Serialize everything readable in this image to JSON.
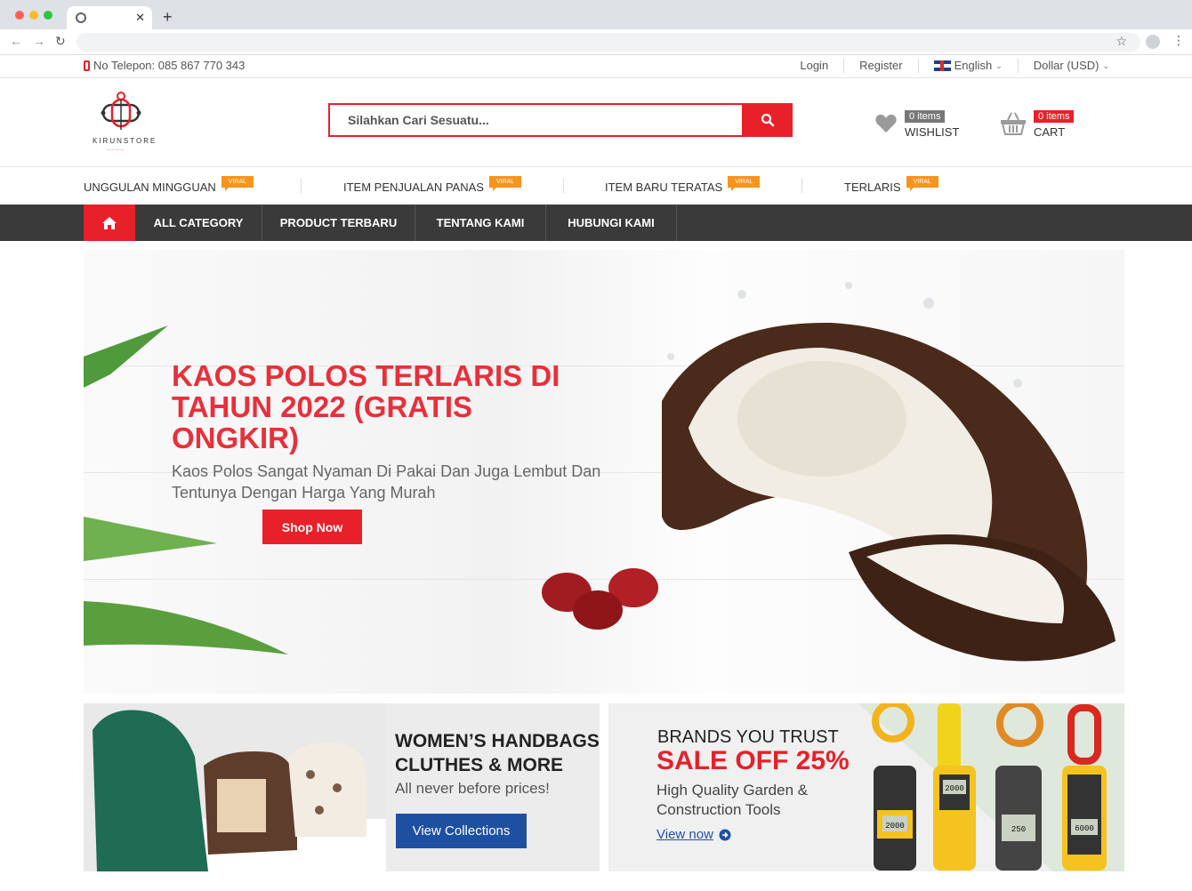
{
  "colors": {
    "accent": "#e8202a",
    "dark_nav": "#3a3a3a",
    "viral_badge": "#f7941d",
    "button_blue": "#1e50a2"
  },
  "topbar": {
    "phone": "No Telepon: 085 867 770 343",
    "login": "Login",
    "register": "Register",
    "language": "English",
    "currency": "Dollar (USD)"
  },
  "header": {
    "logo_text": "KIRUNSTORE",
    "search_placeholder": "Silahkan Cari Sesuatu...",
    "wishlist": {
      "count": "0 items",
      "label": "WISHLIST"
    },
    "cart": {
      "count": "0 items",
      "label": "CART"
    }
  },
  "categories": [
    {
      "label": "UNGGULAN MINGGUAN",
      "badge": "VIRAL"
    },
    {
      "label": "ITEM PENJUALAN PANAS",
      "badge": "VIRAL"
    },
    {
      "label": "ITEM BARU TERATAS",
      "badge": "VIRAL"
    },
    {
      "label": "TERLARIS",
      "badge": "VIRAL"
    }
  ],
  "nav": {
    "items": [
      "ALL CATEGORY",
      "PRODUCT TERBARU",
      "TENTANG KAMI",
      "HUBUNGI KAMI"
    ]
  },
  "hero": {
    "title": "KAOS POLOS TERLARIS DI TAHUN 2022 (GRATIS ONGKIR)",
    "subtitle": "Kaos Polos Sangat Nyaman Di Pakai Dan Juga Lembut Dan Tentunya Dengan Harga Yang Murah",
    "button": "Shop Now"
  },
  "banner_left": {
    "title_line1": "WOMEN’S HANDBAGS",
    "title_line2": "CLUTHES & MORE",
    "subtitle": "All never before prices!",
    "button": "View Collections"
  },
  "banner_right": {
    "line1": "BRANDS YOU TRUST",
    "line2": "SALE OFF 25%",
    "line3": "High Quality Garden &",
    "line4": "Construction Tools",
    "link": "View now",
    "device_readings": [
      "2000",
      "2000",
      "250",
      "6000"
    ]
  }
}
